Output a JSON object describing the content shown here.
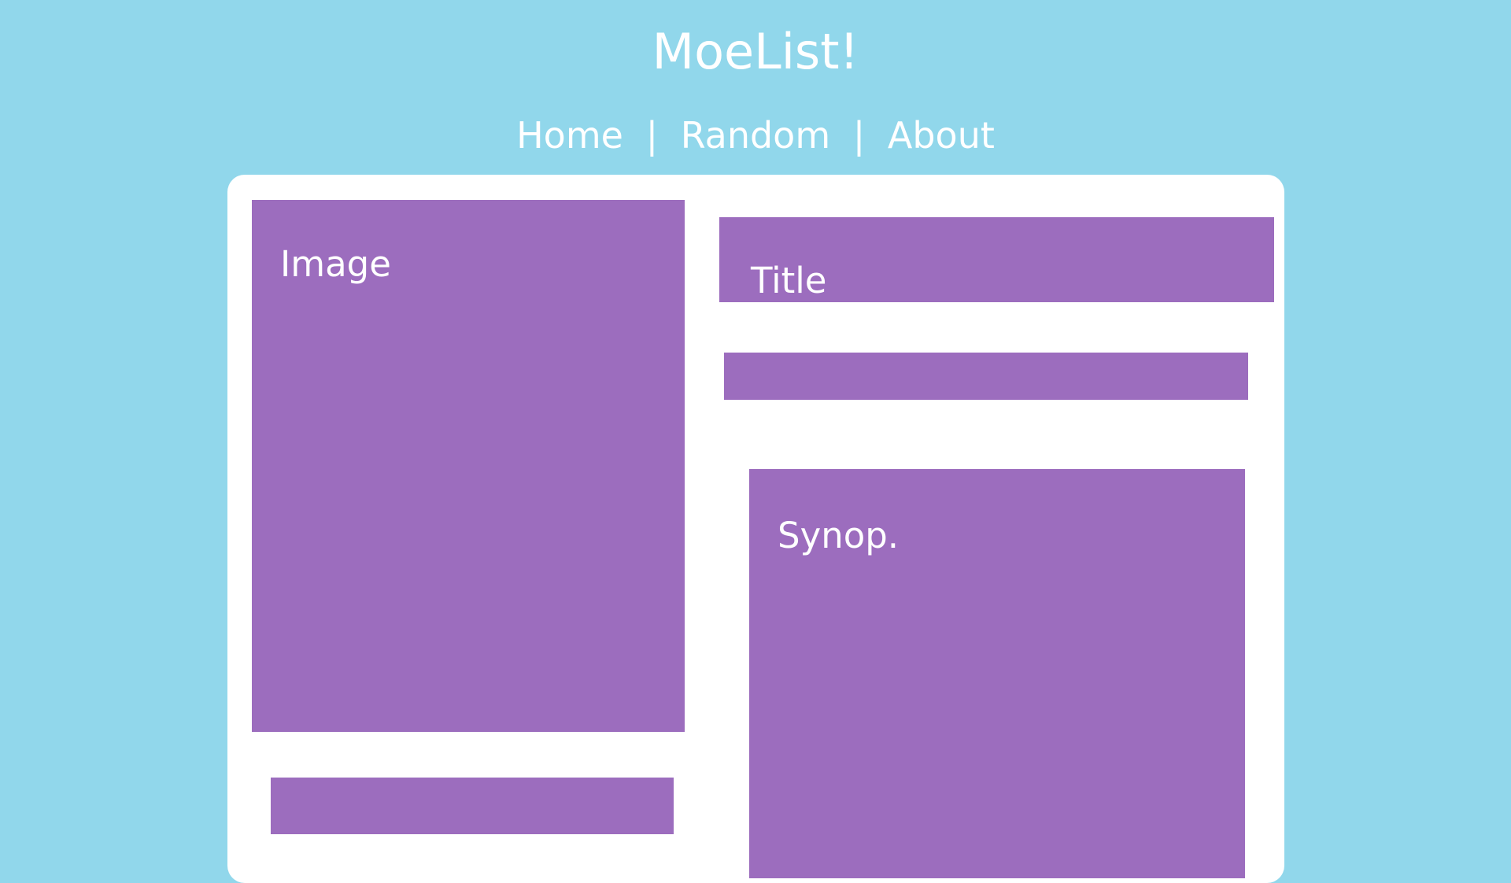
{
  "header": {
    "site_title": "MoeList!"
  },
  "nav": {
    "items": [
      {
        "label": "Home"
      },
      {
        "label": "Random"
      },
      {
        "label": "About"
      }
    ],
    "separator": "|"
  },
  "card": {
    "image_label": "Image",
    "title_label": "Title",
    "synopsis_label": "Synop."
  },
  "colors": {
    "background": "#91d7eb",
    "card": "#ffffff",
    "block": "#9c6dbe",
    "text": "#ffffff"
  }
}
